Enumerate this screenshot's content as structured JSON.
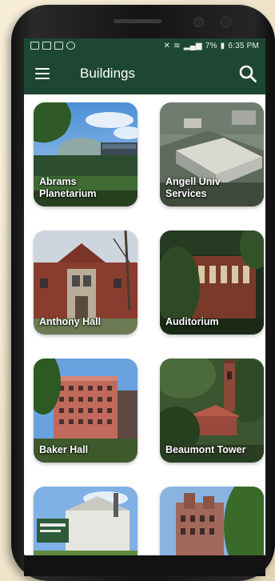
{
  "status_bar": {
    "battery": "7%",
    "time": "6:35 PM"
  },
  "app_bar": {
    "title": "Buildings",
    "menu_icon": "hamburger-menu-icon",
    "search_icon": "search-icon"
  },
  "colors": {
    "brand_green": "#1e4733",
    "card_label_text": "#ffffff"
  },
  "buildings": [
    {
      "name": "Abrams\nPlanetarium"
    },
    {
      "name": "Angell Univ\nServices"
    },
    {
      "name": "Anthony Hall"
    },
    {
      "name": "Auditorium"
    },
    {
      "name": "Baker Hall"
    },
    {
      "name": "Beaumont Tower"
    },
    {
      "name": ""
    },
    {
      "name": ""
    }
  ]
}
